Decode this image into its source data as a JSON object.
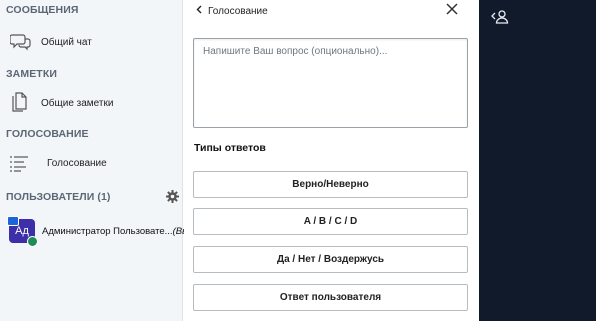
{
  "sidebar": {
    "messages_title": "СООБЩЕНИЯ",
    "public_chat": "Общий чат",
    "notes_title": "ЗАМЕТКИ",
    "shared_notes": "Общие заметки",
    "polling_title": "ГОЛОСОВАНИЕ",
    "polling_item": "Голосование",
    "users_title": "ПОЛЬЗОВАТЕЛИ (1)",
    "users": [
      {
        "initials": "Ад",
        "name": "Администратор Пользовате...",
        "suffix": "(Вы)"
      }
    ]
  },
  "poll": {
    "back_label": "Голосование",
    "question_placeholder": "Напишите Ваш вопрос (опционально)...",
    "types_title": "Типы ответов",
    "answer_types": [
      "Верно/Неверно",
      "A / B / C / D",
      "Да / Нет / Воздержусь",
      "Ответ пользователя"
    ]
  },
  "icons": {
    "chat": "chat-bubbles-icon",
    "notes": "documents-icon",
    "poll": "list-icon",
    "settings": "gear-icon",
    "back": "chevron-left-icon",
    "close": "close-icon",
    "user_toggle": "user-toggle-icon"
  },
  "colors": {
    "sidebar_bg": "#f3f6f9",
    "dark_bg": "#101a2b",
    "avatar_bg": "#3d2fa8",
    "presenter": "#1c65d9",
    "status": "#1e8b58"
  }
}
